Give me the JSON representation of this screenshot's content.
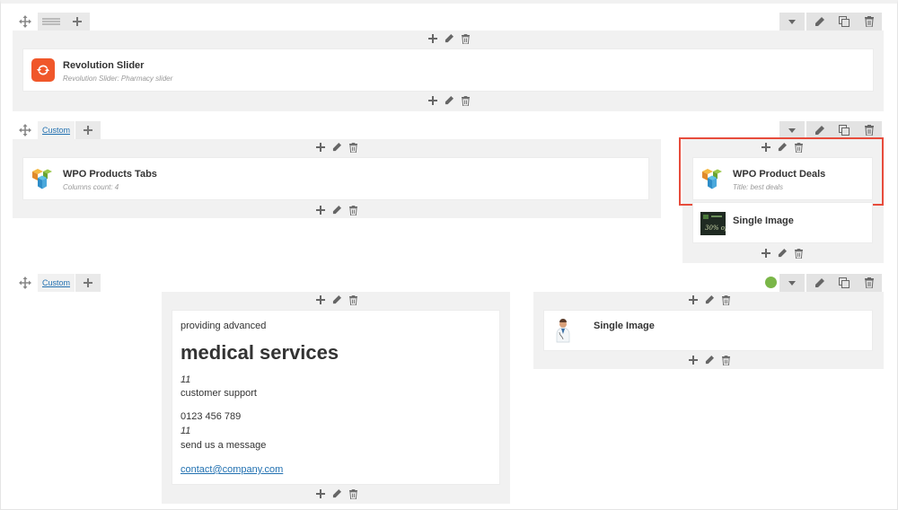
{
  "rows": [
    {
      "elements": [
        {
          "title": "Revolution Slider",
          "subtitle": "Revolution Slider: Pharmacy slider",
          "icon": "revolution-slider-icon"
        }
      ]
    },
    {
      "layout_label": "Custom",
      "columns": [
        {
          "elements": [
            {
              "title": "WPO Products Tabs",
              "subtitle": "Columns count: 4",
              "icon": "wpo-logo-icon"
            }
          ]
        },
        {
          "elements": [
            {
              "title": "WPO Product Deals",
              "subtitle": "Title: best deals",
              "icon": "wpo-logo-icon"
            },
            {
              "title": "Single Image",
              "icon": "thumbnail-image-icon"
            }
          ]
        }
      ]
    },
    {
      "layout_label": "Custom",
      "columns": [
        {
          "text_block": {
            "line1": "providing advanced",
            "heading": "medical services",
            "num1": "11",
            "support": "customer support",
            "phone": "0123 456 789",
            "num2": "11",
            "message": "send us a message",
            "email": "contact@company.com"
          }
        },
        {
          "elements": [
            {
              "title": "Single Image",
              "icon": "doctor-image-icon"
            }
          ]
        }
      ]
    }
  ],
  "colors": {
    "accent": "#2271b1",
    "highlight": "#e74c3c",
    "status_dot": "#7ab648",
    "revolution_icon": "#f0572a"
  }
}
